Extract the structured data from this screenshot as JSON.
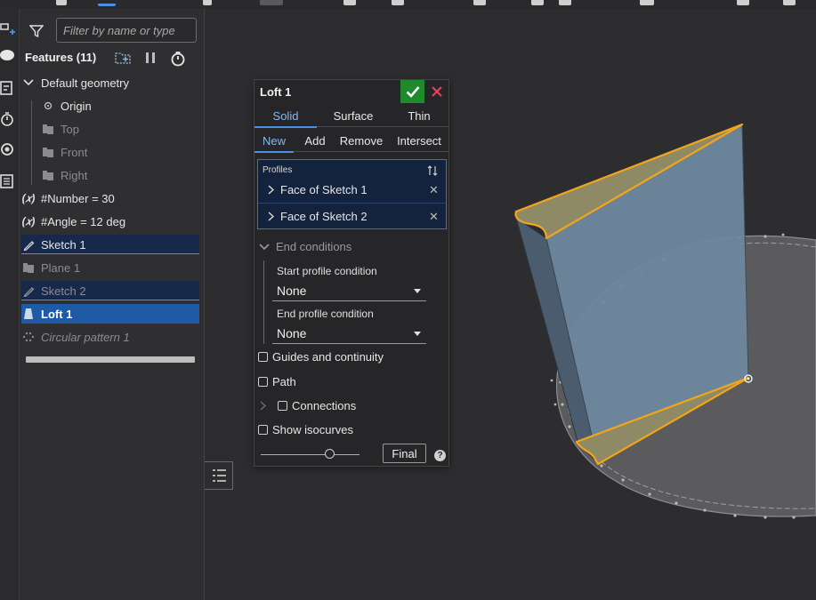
{
  "feature_panel": {
    "filter_placeholder": "Filter by name or type",
    "heading": "Features (11)",
    "items": [
      {
        "label": "Default geometry"
      },
      {
        "label": "Origin"
      },
      {
        "label": "Top"
      },
      {
        "label": "Front"
      },
      {
        "label": "Right"
      },
      {
        "label": "#Number = 30"
      },
      {
        "label": "#Angle = 12 deg"
      },
      {
        "label": "Sketch 1"
      },
      {
        "label": "Plane 1"
      },
      {
        "label": "Sketch 2"
      },
      {
        "label": "Loft 1"
      },
      {
        "label": "Circular pattern 1"
      }
    ]
  },
  "dialog": {
    "title": "Loft 1",
    "type_tabs": [
      "Solid",
      "Surface",
      "Thin"
    ],
    "op_tabs": [
      "New",
      "Add",
      "Remove",
      "Intersect"
    ],
    "profiles_label": "Profiles",
    "profiles": [
      "Face of Sketch 1",
      "Face of Sketch 2"
    ],
    "end_conditions_label": "End conditions",
    "start_label": "Start profile condition",
    "start_value": "None",
    "end_label": "End profile condition",
    "end_value": "None",
    "checkboxes": [
      "Guides and continuity",
      "Path",
      "Connections",
      "Show isocurves"
    ],
    "final_label": "Final",
    "help": "?"
  },
  "colors": {
    "accent": "#4a90e2",
    "accept_green": "#1d8b2b",
    "cancel_red": "#e0455a",
    "edge_orange": "#f2a51a",
    "selected_row": "#1f5aa6"
  }
}
